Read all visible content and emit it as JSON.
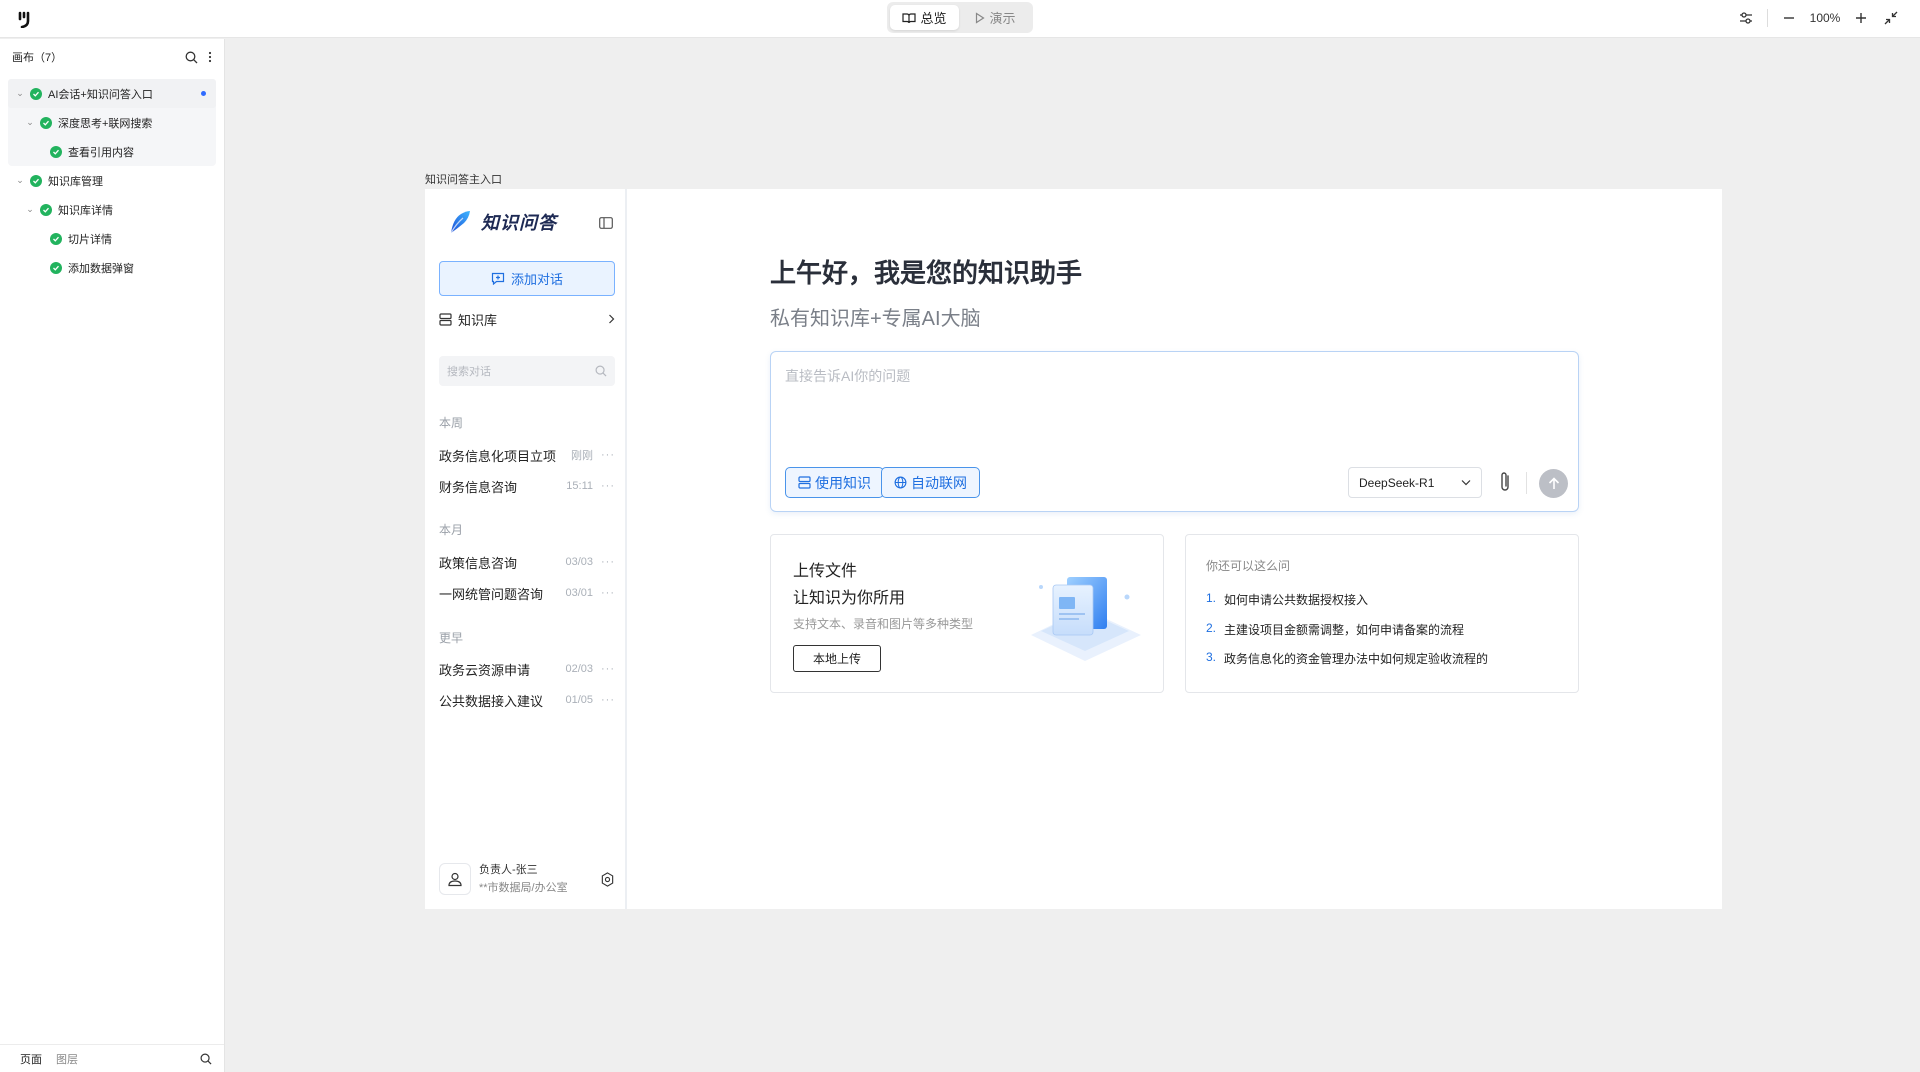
{
  "toolbar": {
    "tab_overview": "总览",
    "tab_present": "演示",
    "zoom": "100%"
  },
  "layers_panel": {
    "title": "画布（7）",
    "nodes": [
      {
        "label": "AI会话+知识问答入口"
      },
      {
        "label": "深度思考+联网搜索"
      },
      {
        "label": "查看引用内容"
      },
      {
        "label": "知识库管理"
      },
      {
        "label": "知识库详情"
      },
      {
        "label": "切片详情"
      },
      {
        "label": "添加数据弹窗"
      }
    ],
    "footer_tab_pages": "页面",
    "footer_tab_layers": "图层"
  },
  "frame": {
    "title": "知识问答主入口"
  },
  "app": {
    "brand": "知识问答",
    "add_chat": "添加对话",
    "knowledge_base": "知识库",
    "search_placeholder": "搜索对话",
    "sections": {
      "week": "本周",
      "month": "本月",
      "earlier": "更早"
    },
    "conversations": [
      {
        "title": "政务信息化项目立项",
        "time": "刚刚"
      },
      {
        "title": "财务信息咨询",
        "time": "15:11"
      },
      {
        "title": "政策信息咨询",
        "time": "03/03"
      },
      {
        "title": "一网统管问题咨询",
        "time": "03/01"
      },
      {
        "title": "政务云资源申请",
        "time": "02/03"
      },
      {
        "title": "公共数据接入建议",
        "time": "01/05"
      }
    ],
    "more": "···",
    "user": {
      "name": "负责人-张三",
      "org": "**市数据局/办公室"
    }
  },
  "main": {
    "greeting": "上午好，我是您的知识助手",
    "subtitle": "私有知识库+专属AI大脑",
    "input_placeholder": "直接告诉AI你的问题",
    "chip_knowledge": "使用知识",
    "chip_web": "自动联网",
    "model": "DeepSeek-R1",
    "upload_card": {
      "line1": "上传文件",
      "line2": "让知识为你所用",
      "desc": "支持文本、录音和图片等多种类型",
      "button": "本地上传"
    },
    "suggest_card": {
      "title": "你还可以这么问",
      "questions": [
        {
          "n": "1.",
          "text": "如何申请公共数据授权接入"
        },
        {
          "n": "2.",
          "text": "主建设项目金额需调整，如何申请备案的流程"
        },
        {
          "n": "3.",
          "text": "政务信息化的资金管理办法中如何规定验收流程的"
        }
      ]
    }
  },
  "colors": {
    "accent": "#1f6fe0",
    "check": "#22b35e"
  }
}
